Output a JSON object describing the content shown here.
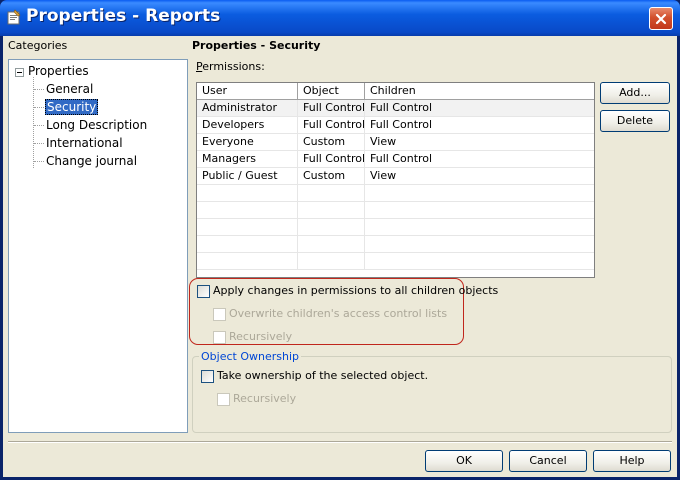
{
  "window": {
    "title": "Properties - Reports"
  },
  "categories": {
    "label": "Categories",
    "root": "Properties",
    "items": [
      "General",
      "Security",
      "Long Description",
      "International",
      "Change journal"
    ],
    "selected": "Security"
  },
  "panel": {
    "title": "Properties - Security",
    "permissions_label_u": "P",
    "permissions_label_rest": "ermissions:",
    "columns": [
      "User",
      "Object",
      "Children"
    ],
    "rows": [
      [
        "Administrator",
        "Full Control",
        "Full Control"
      ],
      [
        "Developers",
        "Full Control",
        "Full Control"
      ],
      [
        "Everyone",
        "Custom",
        "View"
      ],
      [
        "Managers",
        "Full Control",
        "Full Control"
      ],
      [
        "Public / Guest",
        "Custom",
        "View"
      ]
    ],
    "add_label": "Add...",
    "delete_label": "Delete",
    "apply_children_label": "Apply changes in permissions to all children objects",
    "overwrite_acl_label": "Overwrite children's access control lists",
    "recursively_label": "Recursively",
    "ownership_group_title": "Object Ownership",
    "take_ownership_label": "Take ownership of the selected object.",
    "ownership_recursively_label": "Recursively"
  },
  "footer": {
    "ok_label": "OK",
    "cancel_label": "Cancel",
    "help_label": "Help"
  },
  "colors": {
    "accent": "#316ac5",
    "title_bar": "#0b5ce0",
    "highlight_outline": "#c0261c",
    "group_title": "#0046d5"
  }
}
